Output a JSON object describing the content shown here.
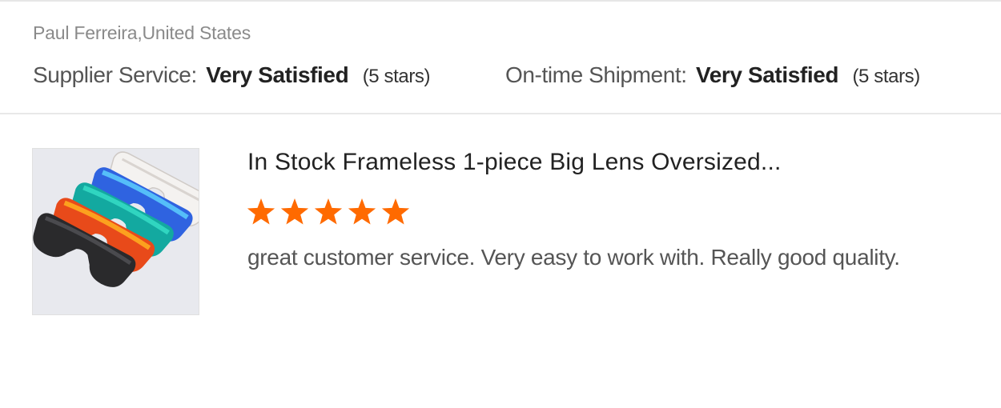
{
  "review": {
    "reviewer": "Paul Ferreira,United States",
    "ratings": [
      {
        "label": "Supplier Service:",
        "value": "Very Satisfied",
        "note": "(5 stars)"
      },
      {
        "label": "On-time Shipment:",
        "value": "Very Satisfied",
        "note": "(5 stars)"
      }
    ],
    "product": {
      "title": "In Stock Frameless 1-piece Big Lens Oversized...",
      "image_icon": "sunglasses-product-photo",
      "stars": 5,
      "star_max": 5,
      "star_color": "#ff6a00",
      "comment": "great customer service. Very easy to work with. Really good quality."
    }
  }
}
